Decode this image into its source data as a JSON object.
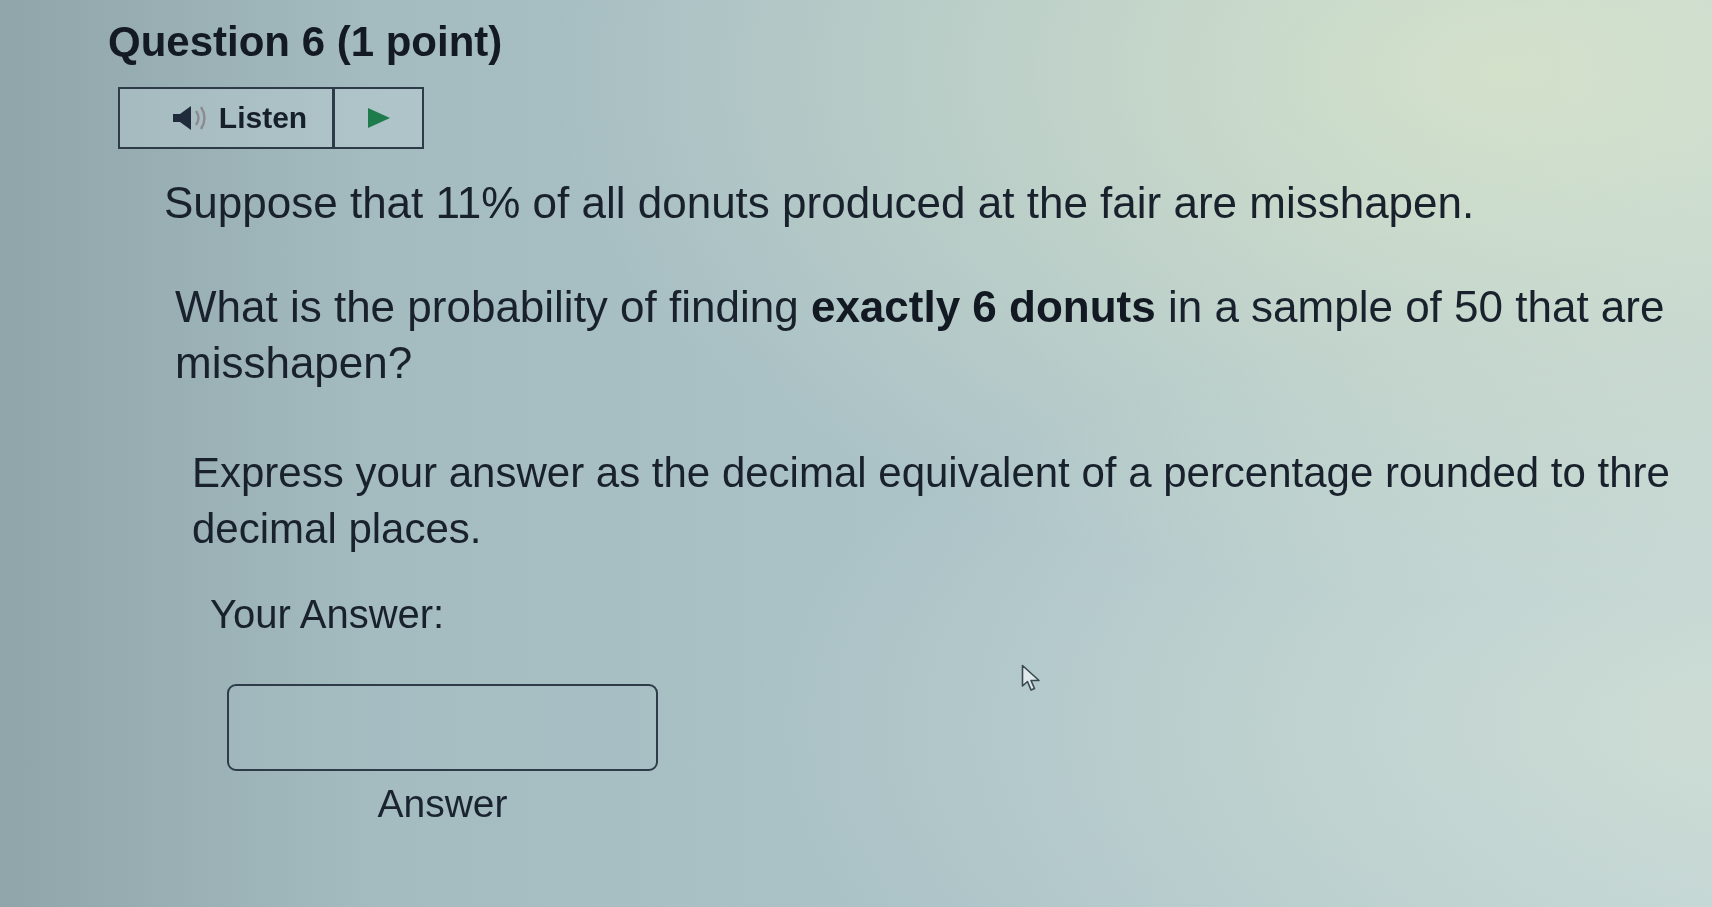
{
  "question": {
    "title": "Question 6 (1 point)"
  },
  "listen": {
    "label": "Listen"
  },
  "paragraphs": [
    "Suppose that 11% of all donuts produced at the fair are misshapen.",
    "What is the probability of finding **exactly 6 donuts** in a sample of 50 that are misshapen?",
    "Express your answer as the decimal equivalent of a percentage rounded to thre decimal places."
  ],
  "answer": {
    "prompt": "Your Answer:",
    "label": "Answer"
  }
}
